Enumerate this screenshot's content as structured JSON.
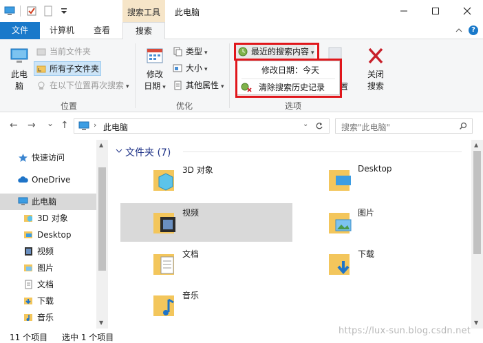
{
  "titlebar": {
    "context_tab": "搜索工具",
    "title": "此电脑",
    "minimize": "—",
    "maximize": "☐",
    "close": "✕"
  },
  "tabs": {
    "file": "文件",
    "computer": "计算机",
    "view": "查看",
    "search": "搜索",
    "collapse_icon": "chevron-up-icon",
    "help": "?"
  },
  "ribbon": {
    "location": {
      "this_pc": "此电脑\n脑",
      "this_pc_line1": "此电",
      "this_pc_line2": "脑",
      "current_folder": "当前文件夹",
      "all_subfolders": "所有子文件夹",
      "search_again": "在以下位置再次搜索",
      "group_label": "位置"
    },
    "refine": {
      "date_modified_line1": "修改",
      "date_modified_line2": "日期",
      "kind": "类型",
      "size": "大小",
      "other_properties": "其他属性",
      "group_label": "优化"
    },
    "options": {
      "recent_searches": "最近的搜索内容",
      "dropdown_item_1": "修改日期：今天",
      "dropdown_item_2": "清除搜索历史记录",
      "partial_label": "置",
      "group_label": "选项"
    },
    "close_search_line1": "关闭",
    "close_search_line2": "搜索"
  },
  "address": {
    "back": "←",
    "forward": "→",
    "recent": "⌄",
    "up": "↑",
    "crumb": "此电脑",
    "search_placeholder": "搜索\"此电脑\""
  },
  "navpane": {
    "quick_access": "快速访问",
    "onedrive": "OneDrive",
    "this_pc": "此电脑",
    "items": [
      "3D 对象",
      "Desktop",
      "视频",
      "图片",
      "文档",
      "下载",
      "音乐"
    ]
  },
  "content": {
    "group_header": "文件夹 (7)",
    "folders": [
      "3D 对象",
      "Desktop",
      "视频",
      "图片",
      "文档",
      "下载",
      "音乐"
    ]
  },
  "status": {
    "item_count": "11 个项目",
    "selected": "选中 1 个项目"
  },
  "watermark": "https://lux-sun.blog.csdn.net",
  "colors": {
    "accent": "#1979ca",
    "context_tab": "#f6e5c8",
    "highlight_box": "#e0161b",
    "selection": "#d9d9d9"
  }
}
